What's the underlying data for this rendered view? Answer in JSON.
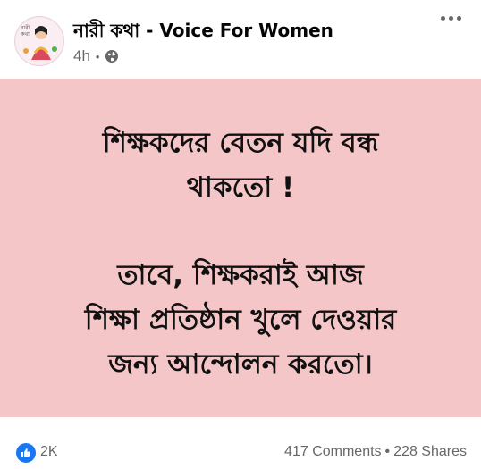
{
  "post": {
    "page_name": "নারী কথা - Voice For Women",
    "time": "4h",
    "separator": "•",
    "avatar_text": "নারী কথা",
    "privacy_icon": "globe-icon",
    "more_icon": "more-options-icon",
    "background_color": "#f4c6c8",
    "lines": [
      "শিক্ষকদের বেতন যদি বন্ধ",
      "থাকতো !",
      "তাবে, শিক্ষকরাই আজ",
      "শিক্ষা প্রতিষ্ঠান খুলে দেওয়ার",
      "জন্য আন্দোলন করতো।"
    ]
  },
  "footer": {
    "reaction_icon": "like-icon",
    "reaction_count": "2K",
    "comments": "417 Comments",
    "separator": "•",
    "shares": "228 Shares"
  }
}
